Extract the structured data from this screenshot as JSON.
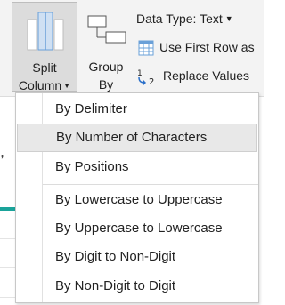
{
  "ribbon": {
    "split_column": {
      "label_line1": "Split",
      "label_line2": "Column",
      "icon": "split-column-icon"
    },
    "group_by": {
      "label_line1": "Group",
      "label_line2": "By",
      "icon": "group-by-icon"
    },
    "data_type": {
      "label": "Data Type: Text"
    },
    "use_first_row": {
      "label": "Use First Row as",
      "icon": "table-grid-icon"
    },
    "replace_values": {
      "label": "Replace Values",
      "icon": "replace-values-icon"
    }
  },
  "background": {
    "partial_text": ", "
  },
  "split_menu": {
    "items": [
      {
        "label": "By Delimiter"
      },
      {
        "label": "By Number of Characters",
        "hovered": true
      },
      {
        "label": "By Positions"
      },
      {
        "label": "By Lowercase to Uppercase"
      },
      {
        "label": "By Uppercase to Lowercase"
      },
      {
        "label": "By Digit to Non-Digit"
      },
      {
        "label": "By Non-Digit to Digit"
      }
    ]
  },
  "colors": {
    "accent_teal": "#1aa39a",
    "split_icon_blue": "#6aa0d8"
  }
}
